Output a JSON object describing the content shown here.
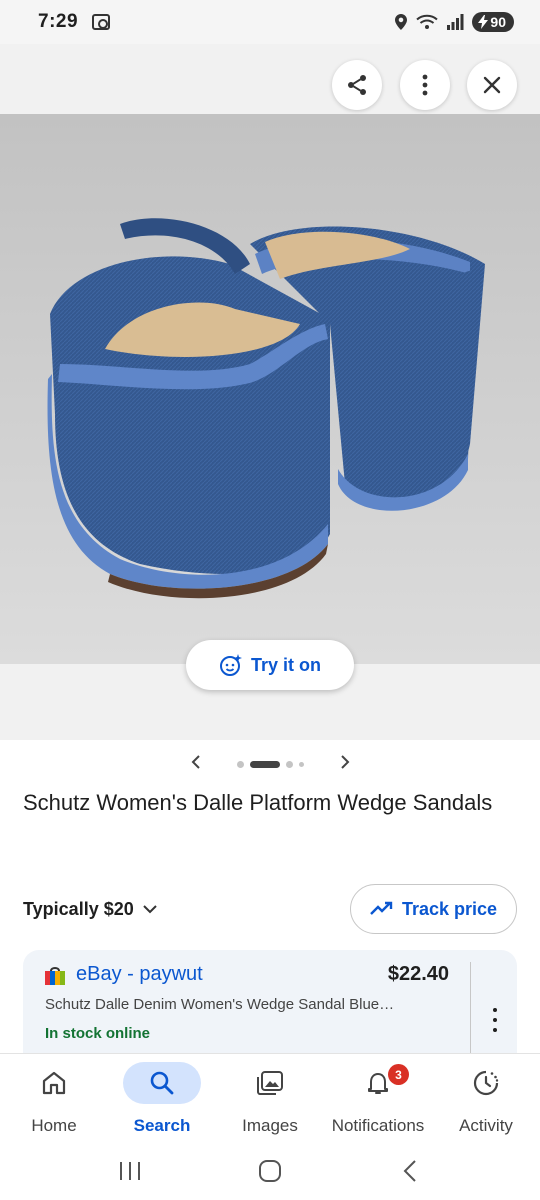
{
  "status_bar": {
    "time": "7:29",
    "battery": "90",
    "icons": [
      "screenshot-icon",
      "location-icon",
      "wifi-icon",
      "signal-icon",
      "battery-charging-icon"
    ]
  },
  "viewer": {
    "share_icon": "share-icon",
    "more_icon": "more-vert-icon",
    "close_icon": "close-icon",
    "try_on_label": "Try it on",
    "pager": {
      "dot_count": 4,
      "active_index": 1
    }
  },
  "product": {
    "title": "Schutz Women's Dalle Platform Wedge Sandals",
    "typical_price": "Typically $20",
    "track_price_label": "Track price"
  },
  "offer": {
    "seller": "eBay - paywut",
    "price": "$22.40",
    "description": "Schutz Dalle Denim Women's Wedge Sandal Blue…",
    "stock": "In stock online"
  },
  "bottom_nav": {
    "items": [
      {
        "label": "Home",
        "icon": "home-icon"
      },
      {
        "label": "Search",
        "icon": "search-icon",
        "active": true
      },
      {
        "label": "Images",
        "icon": "images-icon"
      },
      {
        "label": "Notifications",
        "icon": "bell-icon",
        "badge": "3"
      },
      {
        "label": "Activity",
        "icon": "activity-icon"
      }
    ]
  },
  "colors": {
    "accent": "#0b57d0",
    "active_pill": "#d3e3fd",
    "in_stock": "#137333",
    "badge": "#d93025",
    "card_bg": "#f0f4f9"
  }
}
